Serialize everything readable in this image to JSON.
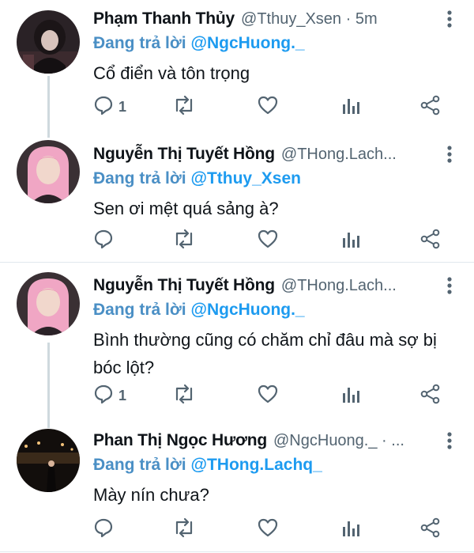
{
  "reply_prefix": "Đang trả lời",
  "colors": {
    "accent": "#1d9bf0",
    "muted": "#536471",
    "thread_line": "#cfd9de"
  },
  "icons": [
    "reply-icon",
    "retweet-icon",
    "like-icon",
    "views-icon",
    "share-icon",
    "more-icon"
  ],
  "tweets": [
    {
      "name": "Phạm Thanh Thủy",
      "handle": "@Tthuy_Xsen · 5m",
      "reply_to": "@NgcHuong._",
      "text": "Cổ điển và tôn trọng",
      "reply_count": "1"
    },
    {
      "name": "Nguyễn Thị Tuyết Hồng",
      "handle": "@THong.Lach...",
      "reply_to": "@Tthuy_Xsen",
      "text": "Sen ơi mệt quá sảng à?",
      "reply_count": ""
    },
    {
      "name": "Nguyễn Thị Tuyết Hồng",
      "handle": "@THong.Lach...",
      "reply_to": "@NgcHuong._",
      "text": "Bình thường cũng có chăm chỉ đâu mà sợ bị bóc lột?",
      "reply_count": "1"
    },
    {
      "name": "Phan Thị Ngọc Hương",
      "handle": "@NgcHuong._ · ...",
      "reply_to": "@THong.Lachq_",
      "text": "Mày nín chưa?",
      "reply_count": ""
    }
  ]
}
